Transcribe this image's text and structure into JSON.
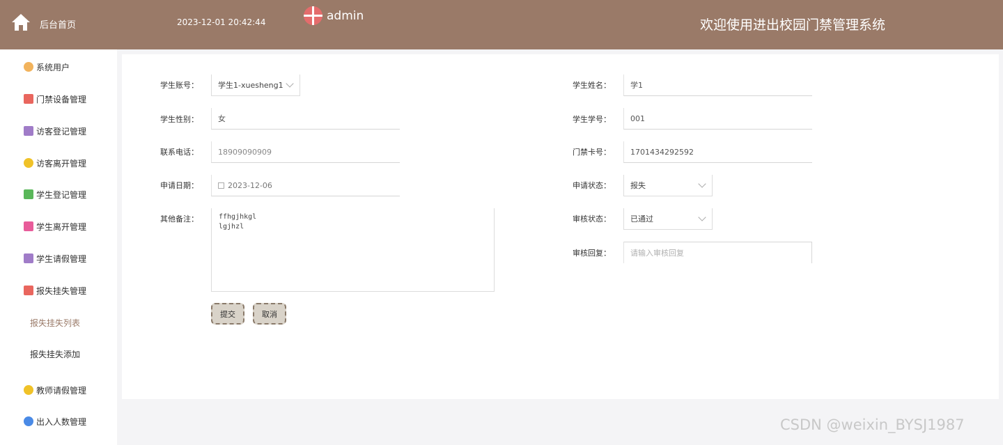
{
  "header": {
    "home_label": "后台首页",
    "datetime": "2023-12-01 20:42:44",
    "username": "admin",
    "system_title": "欢迎使用进出校园门禁管理系统"
  },
  "sidebar": {
    "items": [
      {
        "label": "系统用户",
        "icon_color": "#f2b35c"
      },
      {
        "label": "门禁设备管理",
        "icon_color": "#e9665e"
      },
      {
        "label": "访客登记管理",
        "icon_color": "#a07cc8"
      },
      {
        "label": "访客离开管理",
        "icon_color": "#f0c228"
      },
      {
        "label": "学生登记管理",
        "icon_color": "#5ab75a"
      },
      {
        "label": "学生离开管理",
        "icon_color": "#e85c9a"
      },
      {
        "label": "学生请假管理",
        "icon_color": "#a07cc8"
      },
      {
        "label": "报失挂失管理",
        "icon_color": "#e9665e"
      },
      {
        "label": "报失挂失列表"
      },
      {
        "label": "报失挂失添加"
      },
      {
        "label": "教师请假管理",
        "icon_color": "#f0c228"
      },
      {
        "label": "出入人数管理",
        "icon_color": "#4a8ae6"
      }
    ]
  },
  "form": {
    "student_account": {
      "label": "学生账号：",
      "value": "学生1-xuesheng1"
    },
    "student_name": {
      "label": "学生姓名：",
      "value": "学1"
    },
    "student_gender": {
      "label": "学生性别：",
      "value": "女"
    },
    "student_no": {
      "label": "学生学号：",
      "value": "001"
    },
    "phone": {
      "label": "联系电话：",
      "value": "18909090909"
    },
    "card_no": {
      "label": "门禁卡号：",
      "value": "1701434292592"
    },
    "apply_date": {
      "label": "申请日期：",
      "value": "2023-12-06"
    },
    "apply_status": {
      "label": "申请状态：",
      "value": "报失"
    },
    "remarks": {
      "label": "其他备注：",
      "value": "ffhgjhkgl\nlgjhzl"
    },
    "review_status": {
      "label": "审核状态：",
      "value": "已通过"
    },
    "review_reply": {
      "label": "审核回复：",
      "placeholder": "请输入审核回复"
    },
    "submit_label": "提交",
    "cancel_label": "取消"
  },
  "watermark": "CSDN @weixin_BYSJ1987"
}
